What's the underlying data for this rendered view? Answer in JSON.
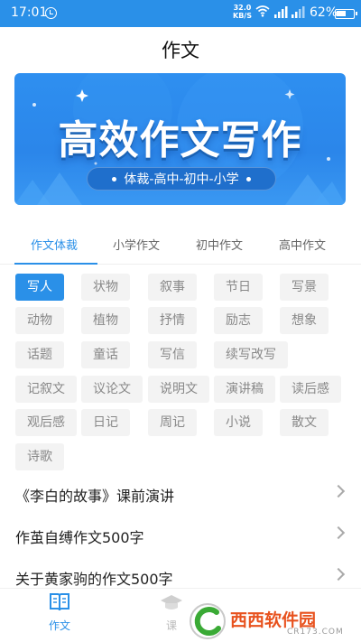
{
  "status_bar": {
    "time": "17:01",
    "net_speed_value": "32.0",
    "net_speed_unit": "KB/S",
    "battery": "62%",
    "battery_level": 0.62
  },
  "header": {
    "title": "作文"
  },
  "banner": {
    "title": "高效作文写作",
    "subtitle": "体裁-高中-初中-小学"
  },
  "tabs": [
    {
      "label": "作文体裁",
      "active": true
    },
    {
      "label": "小学作文",
      "active": false
    },
    {
      "label": "初中作文",
      "active": false
    },
    {
      "label": "高中作文",
      "active": false
    }
  ],
  "tags": [
    "写人",
    "状物",
    "叙事",
    "节日",
    "写景",
    "动物",
    "植物",
    "抒情",
    "励志",
    "想象",
    "话题",
    "童话",
    "写信",
    "续写改写",
    "记叙文",
    "议论文",
    "说明文",
    "演讲稿",
    "读后感",
    "观后感",
    "日记",
    "周记",
    "小说",
    "散文",
    "诗歌"
  ],
  "selected_tag": "写人",
  "articles": [
    "《李白的故事》课前演讲",
    "作茧自缚作文500字",
    "关于黄家驹的作文500字"
  ],
  "bottom_nav": [
    {
      "label": "作文",
      "icon": "book-icon",
      "active": true
    },
    {
      "label": "课",
      "icon": "grad-cap-icon",
      "active": false
    }
  ],
  "watermark": {
    "brand": "西西软件园",
    "url": "CR173.COM"
  },
  "colors": {
    "accent": "#2a90e8",
    "tag_bg": "#f3f3f3",
    "tag_text": "#888888"
  }
}
